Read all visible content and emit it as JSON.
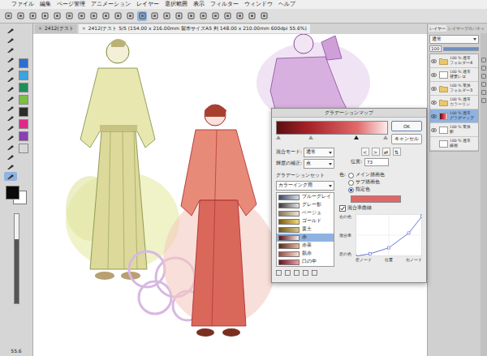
{
  "menu": [
    "ファイル",
    "編集",
    "ページ管理",
    "アニメーション",
    "レイヤー",
    "選択範囲",
    "表示",
    "フィルター",
    "ウィンドウ",
    "ヘルプ"
  ],
  "toolbar": [
    {
      "selected": false
    },
    {
      "selected": false
    },
    {
      "selected": false
    },
    {
      "selected": false
    },
    {
      "selected": false
    },
    {
      "selected": false
    },
    {
      "selected": false
    },
    {
      "selected": false
    },
    {
      "selected": false
    },
    {
      "selected": false
    },
    {
      "selected": false
    },
    {
      "selected": true
    },
    {
      "selected": false
    },
    {
      "selected": false
    },
    {
      "selected": false
    },
    {
      "selected": false
    },
    {
      "selected": false
    },
    {
      "selected": false
    },
    {
      "selected": false
    },
    {
      "selected": false
    },
    {
      "selected": false
    },
    {
      "selected": false
    }
  ],
  "tools": [
    {
      "selected": false
    },
    {
      "selected": false
    },
    {
      "selected": false
    },
    {
      "selected": false
    },
    {
      "selected": false
    },
    {
      "selected": false
    },
    {
      "selected": false
    },
    {
      "selected": false
    },
    {
      "selected": false
    },
    {
      "selected": false
    },
    {
      "selected": false
    },
    {
      "selected": false
    },
    {
      "selected": false
    },
    {
      "selected": false
    },
    {
      "selected": false
    },
    {
      "selected": true
    }
  ],
  "palette": [
    {
      "color": "#2f6fd0"
    },
    {
      "color": "#3aa3e0"
    },
    {
      "color": "#1f8f5a"
    },
    {
      "color": "#7bbf43"
    },
    {
      "color": "#2c2c2c"
    },
    {
      "color": "#e0288a"
    },
    {
      "color": "#8a3fb5"
    },
    {
      "color": "#d8d8d8"
    }
  ],
  "drawing_colors": {
    "main": "#0a0a0a",
    "sub": "#ffffff"
  },
  "brush_size": {
    "level": 0.72
  },
  "zoom": "55.6",
  "tabs": [
    {
      "label": "2412(テスト",
      "close": "×",
      "selected": false
    },
    {
      "label": "2412(テスト 5/5 (154.00 x 216.00mm 製本サイズA5 判 148.00 x 210.00mm 600dpi 55.6%)",
      "close": "×",
      "selected": true
    }
  ],
  "layer_panel": {
    "tabs": [
      {
        "label": "レイヤー",
        "selected": true
      },
      {
        "label": "レイヤープロパティ",
        "selected": false
      }
    ],
    "blend_mode": "通常",
    "opacity": "100",
    "opacity_level": 1.0,
    "layers": [
      {
        "opacity": "100 %",
        "mode": "通常",
        "name": "フォルダー4",
        "kind": "folder",
        "visible": true,
        "selected": false
      },
      {
        "opacity": "100 %",
        "mode": "通常",
        "name": "背景レコ",
        "kind": "raster",
        "visible": true,
        "selected": false
      },
      {
        "opacity": "100 %",
        "mode": "乗算",
        "name": "フォルダー3",
        "kind": "folder",
        "visible": true,
        "selected": false
      },
      {
        "opacity": "100 %",
        "mode": "通常",
        "name": "カラーリン",
        "kind": "folder",
        "visible": true,
        "selected": false
      },
      {
        "opacity": "100 %",
        "mode": "通常",
        "name": "グラデマップ",
        "kind": "gradient",
        "visible": true,
        "selected": true
      },
      {
        "opacity": "100 %",
        "mode": "乗算",
        "name": "影",
        "kind": "raster",
        "visible": true,
        "selected": false
      },
      {
        "opacity": "100 %",
        "mode": "通常",
        "name": "線画",
        "kind": "raster",
        "visible": false,
        "selected": false
      }
    ]
  },
  "dialog": {
    "title": "グラデーションマップ",
    "gradient": [
      {
        "color": "#5a0f12",
        "position": 0,
        "selected": false
      },
      {
        "color": "#a8232a",
        "position": 0.3,
        "selected": false
      },
      {
        "color": "#e06a6a",
        "position": 0.73,
        "selected": true
      },
      {
        "color": "#fbecec",
        "position": 1,
        "selected": false
      }
    ],
    "ok": "OK",
    "cancel": "キャンセル",
    "blend_label": "混合モード:",
    "blend_value": "通常",
    "luminance_label": "輝度の補正:",
    "luminance_value": "点",
    "nav": [
      "<",
      ">",
      "⇄",
      "⇅"
    ],
    "position_label": "位置:",
    "position_value": "73",
    "set_label": "グラデーションセット",
    "set_value": "カラーイング用",
    "sets": [
      {
        "name": "ブルーグレイ",
        "colors": [
          "#3e4a66",
          "#d6dbe6"
        ],
        "selected": false
      },
      {
        "name": "グレー影",
        "colors": [
          "#3a3a3a",
          "#e4e4e4"
        ],
        "selected": false
      },
      {
        "name": "ベージュ",
        "colors": [
          "#8a7656",
          "#efe6cf"
        ],
        "selected": false
      },
      {
        "name": "ゴールド",
        "colors": [
          "#7a5a10",
          "#f2da7a"
        ],
        "selected": false
      },
      {
        "name": "黄土",
        "colors": [
          "#6d5a1e",
          "#d9c58a"
        ],
        "selected": false
      },
      {
        "name": "赤",
        "colors": [
          "#5a0f12",
          "#fbecec"
        ],
        "selected": true
      },
      {
        "name": "赤茶",
        "colors": [
          "#5a2a1a",
          "#e8b8a0"
        ],
        "selected": false
      },
      {
        "name": "肌赤",
        "colors": [
          "#9a4a40",
          "#f8dcd0"
        ],
        "selected": false
      },
      {
        "name": "口の中",
        "colors": [
          "#6a1020",
          "#f0a0a8"
        ],
        "selected": false
      }
    ],
    "color_label": "色:",
    "color_options": [
      {
        "label": "メイン描画色",
        "selected": false
      },
      {
        "label": "サブ描画色",
        "selected": false
      },
      {
        "label": "指定色",
        "selected": true
      }
    ],
    "node_color": "#e06666",
    "curve": {
      "label": "混合率曲線",
      "checked": true,
      "points": [
        {
          "x": 0,
          "y": 0
        },
        {
          "x": 0.22,
          "y": 0.06
        },
        {
          "x": 0.5,
          "y": 0.2
        },
        {
          "x": 0.8,
          "y": 0.55
        },
        {
          "x": 1,
          "y": 0.95
        }
      ],
      "y_labels": [
        "右の色",
        "混合率",
        "左の色"
      ],
      "x_labels": [
        "左ノード",
        "位置",
        "右ノード"
      ]
    }
  }
}
